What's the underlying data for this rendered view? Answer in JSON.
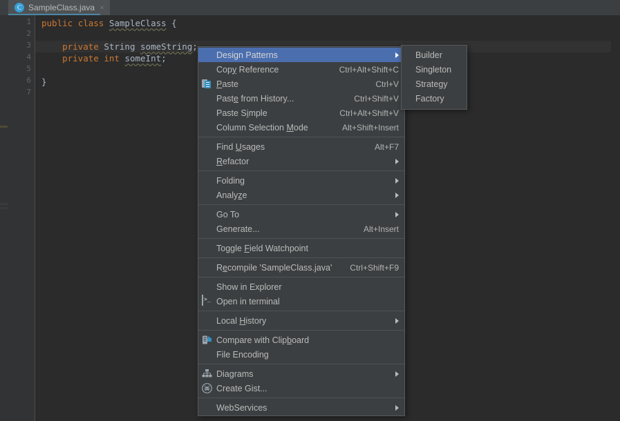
{
  "tab": {
    "label": "SampleClass.java",
    "icon": "java-class-icon",
    "icon_letter": "C",
    "close": "×",
    "accent_color": "#4a88a8"
  },
  "editor": {
    "line_numbers": [
      "1",
      "2",
      "3",
      "4",
      "5",
      "6",
      "7"
    ],
    "caret_line": 3,
    "lines": [
      {
        "n": 1,
        "tokens": [
          {
            "text": "public",
            "style": "kw"
          },
          {
            "text": " ",
            "style": "plain"
          },
          {
            "text": "class",
            "style": "kw"
          },
          {
            "text": " ",
            "style": "plain"
          },
          {
            "text": "SampleClass",
            "style": "warn"
          },
          {
            "text": " {",
            "style": "plain"
          }
        ]
      },
      {
        "n": 2,
        "tokens": []
      },
      {
        "n": 3,
        "tokens": [
          {
            "text": "    ",
            "style": "plain"
          },
          {
            "text": "private",
            "style": "kw"
          },
          {
            "text": " ",
            "style": "plain"
          },
          {
            "text": "String",
            "style": "type"
          },
          {
            "text": " ",
            "style": "plain"
          },
          {
            "text": "someString",
            "style": "warn"
          },
          {
            "text": ";",
            "style": "plain"
          }
        ]
      },
      {
        "n": 4,
        "tokens": [
          {
            "text": "    ",
            "style": "plain"
          },
          {
            "text": "private",
            "style": "kw"
          },
          {
            "text": " ",
            "style": "plain"
          },
          {
            "text": "int",
            "style": "kw"
          },
          {
            "text": " ",
            "style": "plain"
          },
          {
            "text": "someInt",
            "style": "warn"
          },
          {
            "text": ";",
            "style": "plain"
          }
        ]
      },
      {
        "n": 5,
        "tokens": []
      },
      {
        "n": 6,
        "tokens": [
          {
            "text": "}",
            "style": "plain"
          }
        ]
      },
      {
        "n": 7,
        "tokens": []
      }
    ]
  },
  "context_menu": {
    "items": [
      {
        "type": "item",
        "label": "Design Patterns",
        "mnemonic": "",
        "accel": "",
        "submenu": true,
        "selected": true,
        "icon": ""
      },
      {
        "type": "item",
        "label": "Copy Reference",
        "mnemonic": "y",
        "accel": "Ctrl+Alt+Shift+C",
        "submenu": false,
        "selected": false,
        "icon": ""
      },
      {
        "type": "item",
        "label": "Paste",
        "mnemonic": "P",
        "accel": "Ctrl+V",
        "submenu": false,
        "selected": false,
        "icon": "clipboard-icon"
      },
      {
        "type": "item",
        "label": "Paste from History...",
        "mnemonic": "e",
        "accel": "Ctrl+Shift+V",
        "submenu": false,
        "selected": false,
        "icon": ""
      },
      {
        "type": "item",
        "label": "Paste Simple",
        "mnemonic": "i",
        "accel": "Ctrl+Alt+Shift+V",
        "submenu": false,
        "selected": false,
        "icon": ""
      },
      {
        "type": "item",
        "label": "Column Selection Mode",
        "mnemonic": "M",
        "accel": "Alt+Shift+Insert",
        "submenu": false,
        "selected": false,
        "icon": ""
      },
      {
        "type": "separator"
      },
      {
        "type": "item",
        "label": "Find Usages",
        "mnemonic": "U",
        "accel": "Alt+F7",
        "submenu": false,
        "selected": false,
        "icon": ""
      },
      {
        "type": "item",
        "label": "Refactor",
        "mnemonic": "R",
        "accel": "",
        "submenu": true,
        "selected": false,
        "icon": ""
      },
      {
        "type": "separator"
      },
      {
        "type": "item",
        "label": "Folding",
        "mnemonic": "",
        "accel": "",
        "submenu": true,
        "selected": false,
        "icon": ""
      },
      {
        "type": "item",
        "label": "Analyze",
        "mnemonic": "z",
        "accel": "",
        "submenu": true,
        "selected": false,
        "icon": ""
      },
      {
        "type": "separator"
      },
      {
        "type": "item",
        "label": "Go To",
        "mnemonic": "",
        "accel": "",
        "submenu": true,
        "selected": false,
        "icon": ""
      },
      {
        "type": "item",
        "label": "Generate...",
        "mnemonic": "",
        "accel": "Alt+Insert",
        "submenu": false,
        "selected": false,
        "icon": ""
      },
      {
        "type": "separator"
      },
      {
        "type": "item",
        "label": "Toggle Field Watchpoint",
        "mnemonic": "F",
        "accel": "",
        "submenu": false,
        "selected": false,
        "icon": ""
      },
      {
        "type": "separator"
      },
      {
        "type": "item",
        "label": "Recompile 'SampleClass.java'",
        "mnemonic": "e",
        "accel": "Ctrl+Shift+F9",
        "submenu": false,
        "selected": false,
        "icon": ""
      },
      {
        "type": "separator"
      },
      {
        "type": "item",
        "label": "Show in Explorer",
        "mnemonic": "",
        "accel": "",
        "submenu": false,
        "selected": false,
        "icon": ""
      },
      {
        "type": "item",
        "label": "Open in terminal",
        "mnemonic": "",
        "accel": "",
        "submenu": false,
        "selected": false,
        "icon": "terminal-icon"
      },
      {
        "type": "separator"
      },
      {
        "type": "item",
        "label": "Local History",
        "mnemonic": "H",
        "accel": "",
        "submenu": true,
        "selected": false,
        "icon": ""
      },
      {
        "type": "separator"
      },
      {
        "type": "item",
        "label": "Compare with Clipboard",
        "mnemonic": "b",
        "accel": "",
        "submenu": false,
        "selected": false,
        "icon": "compare-clipboard-icon"
      },
      {
        "type": "item",
        "label": "File Encoding",
        "mnemonic": "",
        "accel": "",
        "submenu": false,
        "selected": false,
        "icon": ""
      },
      {
        "type": "separator"
      },
      {
        "type": "item",
        "label": "Diagrams",
        "mnemonic": "",
        "accel": "",
        "submenu": true,
        "selected": false,
        "icon": "diagram-icon"
      },
      {
        "type": "item",
        "label": "Create Gist...",
        "mnemonic": "",
        "accel": "",
        "submenu": false,
        "selected": false,
        "icon": "github-icon"
      },
      {
        "type": "separator"
      },
      {
        "type": "item",
        "label": "WebServices",
        "mnemonic": "",
        "accel": "",
        "submenu": true,
        "selected": false,
        "icon": ""
      }
    ],
    "selection_color": "#4b6eaf",
    "background_color": "#3c3f41"
  },
  "submenu": {
    "parent": "Design Patterns",
    "items": [
      {
        "label": "Builder"
      },
      {
        "label": "Singleton"
      },
      {
        "label": "Strategy"
      },
      {
        "label": "Factory"
      }
    ]
  }
}
